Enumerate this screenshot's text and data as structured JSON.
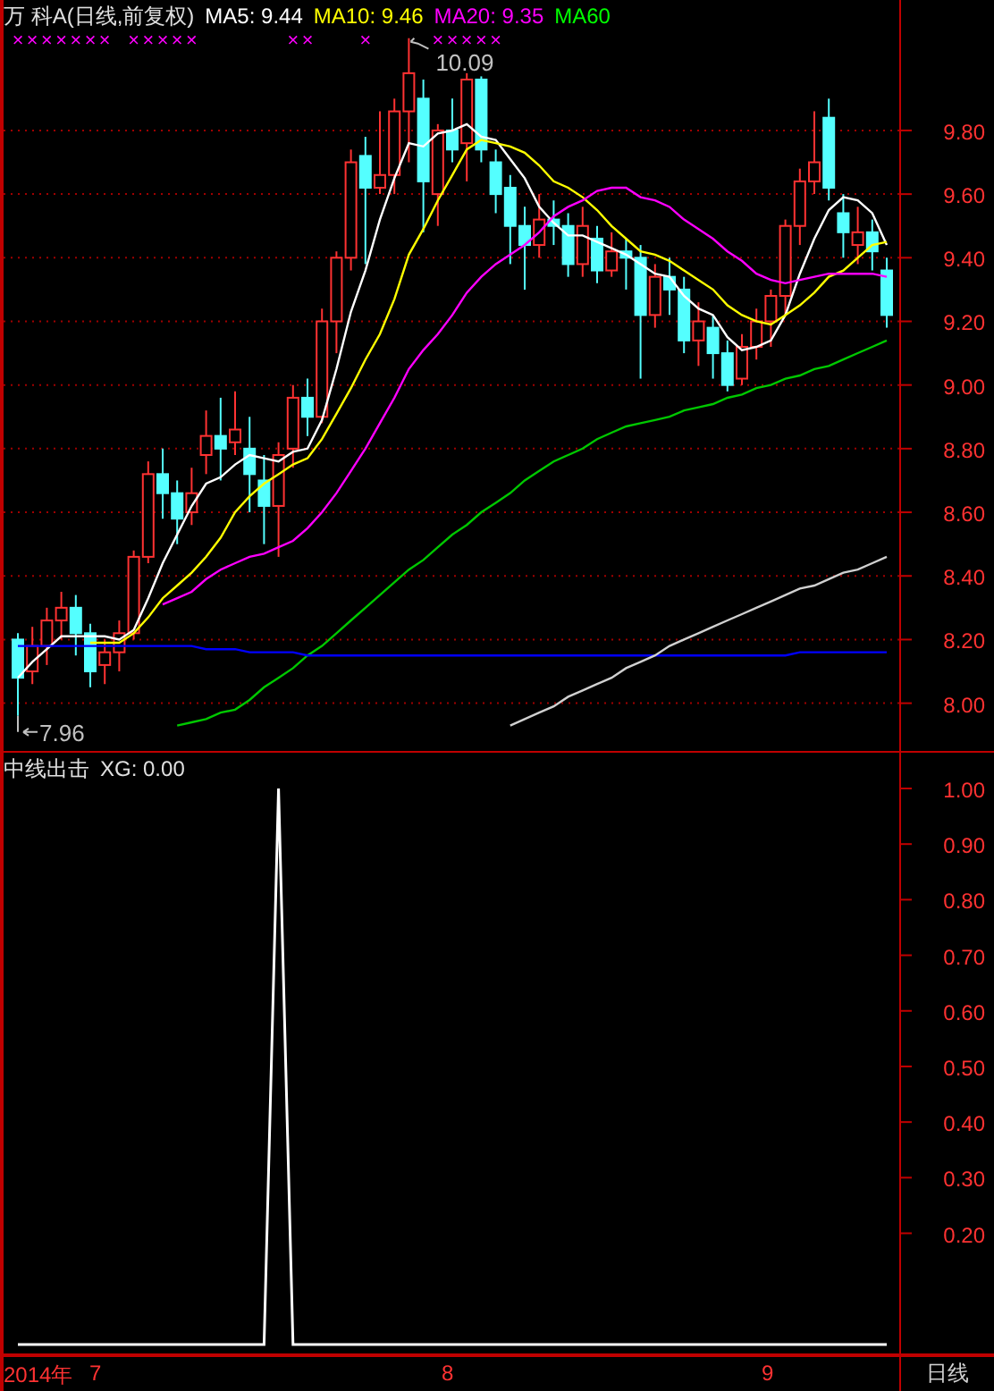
{
  "price_panel": {
    "title": "万 科A(日线,前复权)",
    "ma_labels": [
      {
        "text": "MA5: 9.44",
        "color": "#ffffff"
      },
      {
        "text": "MA10: 9.46",
        "color": "#ffff00"
      },
      {
        "text": "MA20: 9.35",
        "color": "#ff00ff"
      },
      {
        "text": "MA60",
        "color": "#00ff00"
      }
    ],
    "signal_marks": [
      "×××××××",
      "×××××",
      "××",
      "×",
      "×××××"
    ],
    "chart_data": {
      "type": "candlestick",
      "grid": true,
      "ylim": [
        7.85,
        10.21
      ],
      "yticks": [
        {
          "value": 8.0,
          "label": "8.00"
        },
        {
          "value": 8.2,
          "label": "8.20"
        },
        {
          "value": 8.4,
          "label": "8.40"
        },
        {
          "value": 8.6,
          "label": "8.60"
        },
        {
          "value": 8.8,
          "label": "8.80"
        },
        {
          "value": 9.0,
          "label": "9.00"
        },
        {
          "value": 9.2,
          "label": "9.20"
        },
        {
          "value": 9.4,
          "label": "9.40"
        },
        {
          "value": 9.6,
          "label": "9.60"
        },
        {
          "value": 9.8,
          "label": "9.80"
        }
      ],
      "ohlc": [
        [
          8.2,
          8.22,
          7.96,
          8.08
        ],
        [
          8.1,
          8.24,
          8.06,
          8.18
        ],
        [
          8.18,
          8.3,
          8.12,
          8.26
        ],
        [
          8.26,
          8.35,
          8.2,
          8.3
        ],
        [
          8.3,
          8.34,
          8.15,
          8.22
        ],
        [
          8.22,
          8.25,
          8.05,
          8.1
        ],
        [
          8.12,
          8.2,
          8.06,
          8.16
        ],
        [
          8.16,
          8.26,
          8.1,
          8.22
        ],
        [
          8.22,
          8.48,
          8.2,
          8.46
        ],
        [
          8.46,
          8.76,
          8.44,
          8.72
        ],
        [
          8.72,
          8.8,
          8.58,
          8.66
        ],
        [
          8.66,
          8.7,
          8.5,
          8.58
        ],
        [
          8.6,
          8.74,
          8.56,
          8.66
        ],
        [
          8.78,
          8.92,
          8.72,
          8.84
        ],
        [
          8.84,
          8.96,
          8.7,
          8.8
        ],
        [
          8.82,
          8.98,
          8.78,
          8.86
        ],
        [
          8.8,
          8.9,
          8.6,
          8.72
        ],
        [
          8.7,
          8.78,
          8.5,
          8.62
        ],
        [
          8.62,
          8.82,
          8.46,
          8.78
        ],
        [
          8.8,
          9.0,
          8.74,
          8.96
        ],
        [
          8.96,
          9.02,
          8.84,
          8.9
        ],
        [
          8.9,
          9.24,
          8.88,
          9.2
        ],
        [
          9.2,
          9.42,
          9.1,
          9.4
        ],
        [
          9.4,
          9.74,
          9.36,
          9.7
        ],
        [
          9.72,
          9.78,
          9.38,
          9.62
        ],
        [
          9.62,
          9.86,
          9.6,
          9.66
        ],
        [
          9.66,
          9.9,
          9.6,
          9.86
        ],
        [
          9.86,
          10.09,
          9.7,
          9.98
        ],
        [
          9.9,
          9.96,
          9.48,
          9.64
        ],
        [
          9.6,
          9.82,
          9.5,
          9.8
        ],
        [
          9.8,
          9.9,
          9.7,
          9.74
        ],
        [
          9.76,
          9.98,
          9.64,
          9.96
        ],
        [
          9.96,
          9.97,
          9.7,
          9.74
        ],
        [
          9.7,
          9.74,
          9.54,
          9.6
        ],
        [
          9.62,
          9.66,
          9.38,
          9.5
        ],
        [
          9.5,
          9.56,
          9.3,
          9.44
        ],
        [
          9.44,
          9.6,
          9.4,
          9.52
        ],
        [
          9.52,
          9.58,
          9.44,
          9.5
        ],
        [
          9.5,
          9.54,
          9.34,
          9.38
        ],
        [
          9.38,
          9.56,
          9.34,
          9.5
        ],
        [
          9.46,
          9.5,
          9.32,
          9.36
        ],
        [
          9.36,
          9.48,
          9.34,
          9.42
        ],
        [
          9.42,
          9.46,
          9.3,
          9.4
        ],
        [
          9.4,
          9.44,
          9.02,
          9.22
        ],
        [
          9.22,
          9.38,
          9.18,
          9.34
        ],
        [
          9.34,
          9.4,
          9.22,
          9.3
        ],
        [
          9.3,
          9.34,
          9.1,
          9.14
        ],
        [
          9.14,
          9.26,
          9.06,
          9.2
        ],
        [
          9.18,
          9.22,
          9.02,
          9.1
        ],
        [
          9.1,
          9.14,
          8.98,
          9.0
        ],
        [
          9.02,
          9.16,
          9.0,
          9.12
        ],
        [
          9.12,
          9.24,
          9.08,
          9.2
        ],
        [
          9.2,
          9.3,
          9.12,
          9.28
        ],
        [
          9.28,
          9.52,
          9.22,
          9.5
        ],
        [
          9.5,
          9.68,
          9.44,
          9.64
        ],
        [
          9.64,
          9.86,
          9.6,
          9.7
        ],
        [
          9.84,
          9.9,
          9.58,
          9.62
        ],
        [
          9.54,
          9.6,
          9.4,
          9.48
        ],
        [
          9.44,
          9.56,
          9.38,
          9.48
        ],
        [
          9.48,
          9.52,
          9.36,
          9.42
        ],
        [
          9.36,
          9.4,
          9.18,
          9.22
        ]
      ],
      "series": [
        {
          "type": "line",
          "color": "#ffffff",
          "values": [
            8.08,
            8.13,
            8.17,
            8.21,
            8.21,
            8.21,
            8.21,
            8.2,
            8.23,
            8.33,
            8.44,
            8.53,
            8.62,
            8.69,
            8.71,
            8.75,
            8.78,
            8.77,
            8.76,
            8.79,
            8.8,
            8.89,
            9.05,
            9.23,
            9.36,
            9.52,
            9.65,
            9.76,
            9.75,
            9.79,
            9.8,
            9.82,
            9.78,
            9.77,
            9.71,
            9.65,
            9.56,
            9.51,
            9.47,
            9.47,
            9.45,
            9.43,
            9.41,
            9.38,
            9.35,
            9.34,
            9.28,
            9.24,
            9.22,
            9.15,
            9.11,
            9.12,
            9.14,
            9.22,
            9.35,
            9.46,
            9.55,
            9.59,
            9.58,
            9.54,
            9.44
          ]
        },
        {
          "type": "line",
          "color": "#ffff00",
          "values": [
            null,
            null,
            null,
            null,
            null,
            8.19,
            8.19,
            8.19,
            8.22,
            8.27,
            8.33,
            8.37,
            8.41,
            8.46,
            8.52,
            8.6,
            8.65,
            8.69,
            8.72,
            8.75,
            8.77,
            8.83,
            8.91,
            8.99,
            9.08,
            9.16,
            9.27,
            9.41,
            9.49,
            9.58,
            9.66,
            9.74,
            9.77,
            9.76,
            9.75,
            9.73,
            9.69,
            9.64,
            9.62,
            9.59,
            9.55,
            9.5,
            9.46,
            9.42,
            9.41,
            9.39,
            9.36,
            9.33,
            9.3,
            9.25,
            9.22,
            9.2,
            9.19,
            9.22,
            9.25,
            9.29,
            9.34,
            9.36,
            9.4,
            9.44,
            9.45
          ]
        },
        {
          "type": "line",
          "color": "#ff00ff",
          "values": [
            null,
            null,
            null,
            null,
            null,
            null,
            null,
            null,
            null,
            null,
            8.31,
            8.33,
            8.35,
            8.39,
            8.42,
            8.44,
            8.46,
            8.47,
            8.49,
            8.51,
            8.55,
            8.6,
            8.66,
            8.73,
            8.8,
            8.88,
            8.96,
            9.05,
            9.11,
            9.16,
            9.22,
            9.29,
            9.34,
            9.38,
            9.41,
            9.44,
            9.48,
            9.53,
            9.56,
            9.58,
            9.61,
            9.62,
            9.62,
            9.59,
            9.58,
            9.56,
            9.52,
            9.49,
            9.46,
            9.42,
            9.39,
            9.35,
            9.33,
            9.32,
            9.33,
            9.34,
            9.35,
            9.35,
            9.35,
            9.35,
            9.34
          ]
        },
        {
          "type": "line",
          "color": "#00c800",
          "values": [
            null,
            null,
            null,
            null,
            null,
            null,
            null,
            null,
            null,
            null,
            null,
            7.93,
            7.94,
            7.95,
            7.97,
            7.98,
            8.01,
            8.05,
            8.08,
            8.11,
            8.15,
            8.18,
            8.22,
            8.26,
            8.3,
            8.34,
            8.38,
            8.42,
            8.45,
            8.49,
            8.53,
            8.56,
            8.6,
            8.63,
            8.66,
            8.7,
            8.73,
            8.76,
            8.78,
            8.8,
            8.83,
            8.85,
            8.87,
            8.88,
            8.89,
            8.9,
            8.92,
            8.93,
            8.94,
            8.96,
            8.97,
            8.99,
            9.0,
            9.02,
            9.03,
            9.05,
            9.06,
            9.08,
            9.1,
            9.12,
            9.14
          ]
        },
        {
          "type": "line",
          "color": "#0000ff",
          "values": [
            8.18,
            8.18,
            8.18,
            8.18,
            8.18,
            8.18,
            8.18,
            8.18,
            8.18,
            8.18,
            8.18,
            8.18,
            8.18,
            8.17,
            8.17,
            8.17,
            8.16,
            8.16,
            8.16,
            8.16,
            8.15,
            8.15,
            8.15,
            8.15,
            8.15,
            8.15,
            8.15,
            8.15,
            8.15,
            8.15,
            8.15,
            8.15,
            8.15,
            8.15,
            8.15,
            8.15,
            8.15,
            8.15,
            8.15,
            8.15,
            8.15,
            8.15,
            8.15,
            8.15,
            8.15,
            8.15,
            8.15,
            8.15,
            8.15,
            8.15,
            8.15,
            8.15,
            8.15,
            8.15,
            8.16,
            8.16,
            8.16,
            8.16,
            8.16,
            8.16,
            8.16
          ]
        },
        {
          "type": "line",
          "color": "#d0d0d0",
          "values": [
            null,
            null,
            null,
            null,
            null,
            null,
            null,
            null,
            null,
            null,
            null,
            null,
            null,
            null,
            null,
            null,
            null,
            null,
            null,
            null,
            null,
            null,
            null,
            null,
            null,
            null,
            null,
            null,
            null,
            null,
            null,
            null,
            null,
            null,
            7.93,
            7.95,
            7.97,
            7.99,
            8.02,
            8.04,
            8.06,
            8.08,
            8.11,
            8.13,
            8.15,
            8.18,
            8.2,
            8.22,
            8.24,
            8.26,
            8.28,
            8.3,
            8.32,
            8.34,
            8.36,
            8.37,
            8.39,
            8.41,
            8.42,
            8.44,
            8.46
          ]
        }
      ],
      "annotations": [
        {
          "text": "10.09"
        },
        {
          "text": "7.96"
        }
      ]
    }
  },
  "indicator_panel": {
    "title": "中线出击",
    "reading": "XG: 0.00",
    "chart_data": {
      "type": "line",
      "ylim": [
        -0.08,
        1.06
      ],
      "yticks": [
        {
          "value": 0.2,
          "label": "0.20"
        },
        {
          "value": 0.3,
          "label": "0.30"
        },
        {
          "value": 0.4,
          "label": "0.40"
        },
        {
          "value": 0.5,
          "label": "0.50"
        },
        {
          "value": 0.6,
          "label": "0.60"
        },
        {
          "value": 0.7,
          "label": "0.70"
        },
        {
          "value": 0.8,
          "label": "0.80"
        },
        {
          "value": 0.9,
          "label": "0.90"
        },
        {
          "value": 1.0,
          "label": "1.00"
        }
      ],
      "series": [
        {
          "color": "#ffffff",
          "values": [
            0,
            0,
            0,
            0,
            0,
            0,
            0,
            0,
            0,
            0,
            0,
            0,
            0,
            0,
            0,
            0,
            0,
            0,
            1,
            0,
            0,
            0,
            0,
            0,
            0,
            0,
            0,
            0,
            0,
            0,
            0,
            0,
            0,
            0,
            0,
            0,
            0,
            0,
            0,
            0,
            0,
            0,
            0,
            0,
            0,
            0,
            0,
            0,
            0,
            0,
            0,
            0,
            0,
            0,
            0,
            0,
            0,
            0,
            0,
            0,
            0
          ]
        }
      ]
    }
  },
  "date_axis": {
    "labels": [
      "2014年",
      "7",
      "8",
      "9"
    ],
    "period": "日线"
  }
}
